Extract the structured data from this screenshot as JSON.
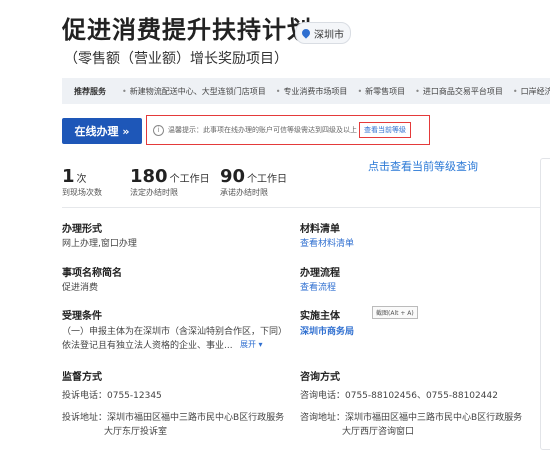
{
  "header": {
    "title": "促进消费提升扶持计划",
    "location": "深圳市",
    "subtitle": "（零售额（营业额）增长奖励项目）"
  },
  "strip": {
    "head": "推荐服务",
    "items": [
      "新建物流配送中心、大型连锁门店项目",
      "专业消费市场项目",
      "新零售项目",
      "进口商品交易平台项目",
      "口岸经济带"
    ]
  },
  "action": {
    "online_label": "在线办理 »",
    "tip_text": "温馨提示：此事项在线办理的账户可信等级需达到四级及以上",
    "tip_link": "查看当前等级",
    "annotation": "点击查看当前等级查询"
  },
  "stats": [
    {
      "num": "1",
      "unit": "次",
      "label": "到现场次数"
    },
    {
      "num": "180",
      "unit": "个工作日",
      "label": "法定办结时限"
    },
    {
      "num": "90",
      "unit": "个工作日",
      "label": "承诺办结时限"
    }
  ],
  "info": {
    "mode_label": "办理形式",
    "mode_value": "网上办理,窗口办理",
    "materials_label": "材料清单",
    "materials_link": "查看材料清单",
    "shortname_label": "事项名称简名",
    "shortname_value": "促进消费",
    "process_label": "办理流程",
    "process_link": "查看流程",
    "conditions_label": "受理条件",
    "conditions_line1": "（一）申报主体为在深圳市（含深汕特别合作区，下同）",
    "conditions_line2": "依法登记且有独立法人资格的企业、事业...",
    "expand": "展开 ▾",
    "subject_label": "实施主体",
    "subject_link": "深圳市商务局",
    "tooltip": "截图(Alt + A)",
    "supervise_label": "监督方式",
    "supervise_phone": "投诉电话：0755-12345",
    "supervise_addr1": "投诉地址：深圳市福田区福中三路市民中心B区行政服务",
    "supervise_addr2": "大厅东厅投诉室",
    "consult_label": "咨询方式",
    "consult_phone": "咨询电话：0755-88102456、0755-88102442",
    "consult_addr1": "咨询地址：深圳市福田区福中三路市民中心B区行政服务",
    "consult_addr2": "大厅西厅咨询窗口"
  }
}
